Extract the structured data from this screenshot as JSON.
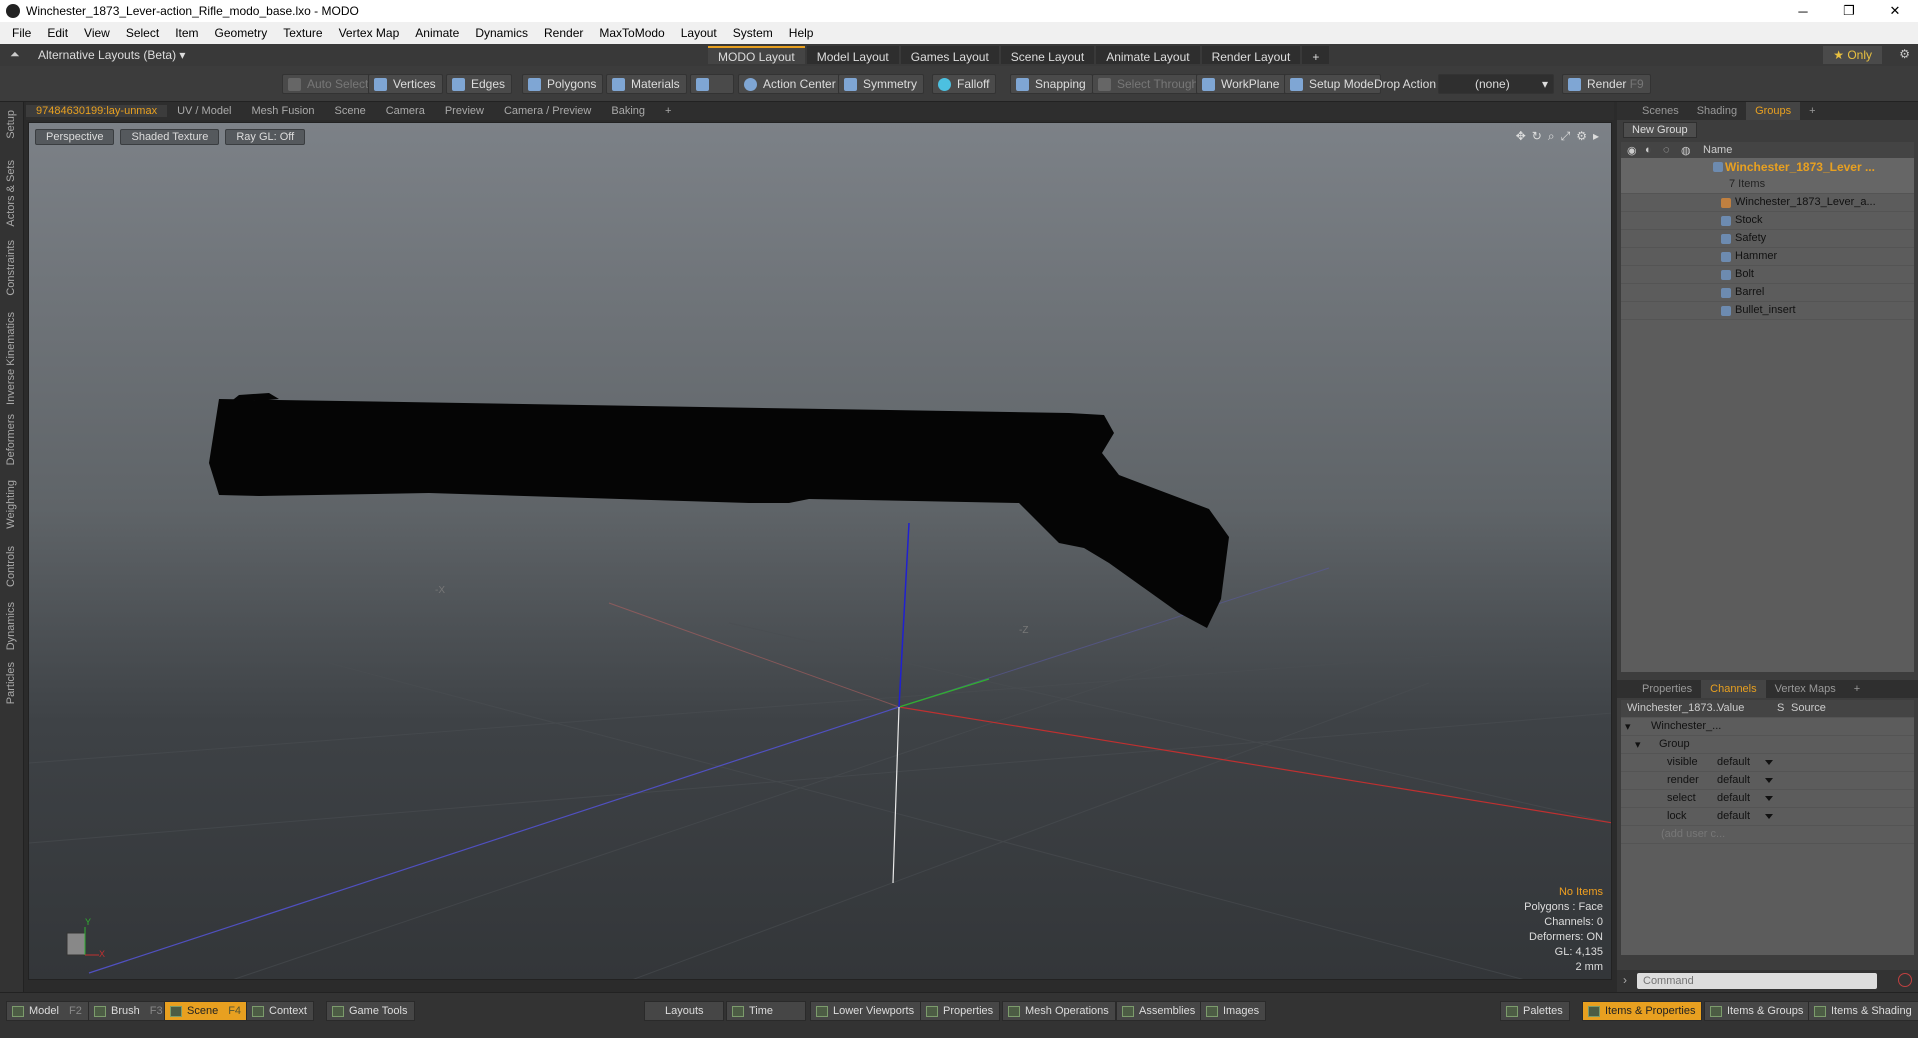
{
  "window": {
    "title": "Winchester_1873_Lever-action_Rifle_modo_base.lxo - MODO",
    "min": "─",
    "max": "❐",
    "close": "✕"
  },
  "menu": [
    "File",
    "Edit",
    "View",
    "Select",
    "Item",
    "Geometry",
    "Texture",
    "Vertex Map",
    "Animate",
    "Dynamics",
    "Render",
    "MaxToModo",
    "Layout",
    "System",
    "Help"
  ],
  "layoutbar": {
    "alt": "Alternative Layouts (Beta) ▾",
    "tabs": [
      "MODO Layout",
      "Model Layout",
      "Games Layout",
      "Scene Layout",
      "Animate Layout",
      "Render Layout"
    ],
    "active_tab": "MODO Layout",
    "add": "+",
    "only": "★ Only",
    "gear": "⚙"
  },
  "toolbar": {
    "auto_select": "Auto Select",
    "vertices": "Vertices",
    "edges": "Edges",
    "polygons": "Polygons",
    "materials": "Materials",
    "action_center": "Action Center",
    "symmetry": "Symmetry",
    "falloff": "Falloff",
    "snapping": "Snapping",
    "select_through": "Select Through",
    "workplane": "WorkPlane",
    "setup_mode": "Setup Mode",
    "drop_action": "Drop Action",
    "drop_value": "(none)",
    "render": "Render",
    "render_key": "F9"
  },
  "left_strip": [
    "Setup",
    "Actors & Sets",
    "Constraints",
    "Inverse Kinematics",
    "Deformers",
    "Weighting",
    "Controls",
    "Dynamics",
    "Particles"
  ],
  "viewport_tabs": [
    "97484630199:lay-unmax",
    "UV / Model",
    "Mesh Fusion",
    "Scene",
    "Camera",
    "Preview",
    "Camera / Preview",
    "Baking",
    "+"
  ],
  "viewport": {
    "perspective": "Perspective",
    "shading": "Shaded Texture",
    "raygl": "Ray GL: Off",
    "axis_y": "Y",
    "axis_x": "X",
    "label_mx": "-X",
    "label_mz": "-Z",
    "info": {
      "no_items": "No Items",
      "polygons": "Polygons : Face",
      "channels": "Channels: 0",
      "deformers": "Deformers: ON",
      "gl": "GL: 4,135",
      "unit": "2 mm"
    }
  },
  "groups_panel": {
    "tabs": [
      "Scenes",
      "Shading",
      "Groups",
      "+"
    ],
    "active": "Groups",
    "new_group": "New Group",
    "col_name": "Name",
    "root": {
      "label": "Winchester_1873_Lever ...",
      "count": "7 Items"
    },
    "items": [
      "Winchester_1873_Lever_a...",
      "Stock",
      "Safety",
      "Hammer",
      "Bolt",
      "Barrel",
      "Bullet_insert"
    ]
  },
  "channels_panel": {
    "tabs": [
      "Properties",
      "Channels",
      "Vertex Maps",
      "+"
    ],
    "active": "Channels",
    "cols": {
      "name": "Winchester_1873...",
      "value": "Value",
      "s": "S",
      "source": "Source"
    },
    "root": "Winchester_...",
    "group": "Group",
    "rows": [
      {
        "name": "visible",
        "value": "default"
      },
      {
        "name": "render",
        "value": "default"
      },
      {
        "name": "select",
        "value": "default"
      },
      {
        "name": "lock",
        "value": "default"
      }
    ],
    "add": "(add user c..."
  },
  "command": {
    "placeholder": "Command"
  },
  "statusbar": {
    "model": "Model",
    "model_key": "F2",
    "brush": "Brush",
    "brush_key": "F3",
    "scene": "Scene",
    "scene_key": "F4",
    "context": "Context",
    "game_tools": "Game Tools",
    "layouts": "Layouts",
    "time": "Time",
    "lower": "Lower Viewports",
    "properties": "Properties",
    "mesh_ops": "Mesh Operations",
    "assemblies": "Assemblies",
    "images": "Images",
    "palettes": "Palettes",
    "items_props": "Items & Properties",
    "items_groups": "Items & Groups",
    "items_shading": "Items & Shading"
  }
}
